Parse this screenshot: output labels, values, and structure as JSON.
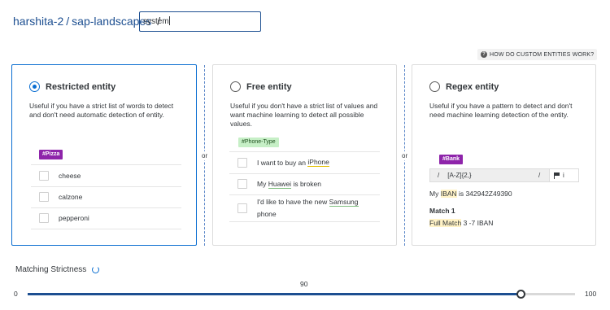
{
  "breadcrumb": {
    "owner": "harshita-2",
    "slash": "/",
    "project": "sap-landscapes",
    "separator": "/"
  },
  "entity_name_input": {
    "value": "system"
  },
  "help_link": {
    "label": "HOW DO CUSTOM ENTITIES WORK?",
    "icon": "question-icon"
  },
  "cards": {
    "restricted": {
      "title": "Restricted entity",
      "selected": true,
      "description": "Useful if you have a strict list of words to detect and don't need automatic detection of entity.",
      "tag": "#Pizza",
      "items": [
        "cheese",
        "calzone",
        "pepperoni"
      ]
    },
    "free": {
      "title": "Free entity",
      "selected": false,
      "description": "Useful if you don't have a strict list of values and want machine learning to detect all possible values.",
      "tag": "#Phone-Type",
      "examples": [
        {
          "before": "I want to buy an",
          "entity": "iPhone",
          "after": ""
        },
        {
          "before": "My",
          "entity": "Huawei",
          "after": "is broken"
        },
        {
          "before": "I'd like to have the new",
          "entity": "Samsung",
          "after": "phone"
        }
      ]
    },
    "regex": {
      "title": "Regex entity",
      "selected": false,
      "description": "Useful if you have a pattern to detect and don't need machine learning detection of the entity.",
      "tag": "#Bank",
      "pattern_open": "/",
      "pattern": "[A-Z]{2,}",
      "pattern_close": "/",
      "flags": "i",
      "test_before": "My",
      "test_match": "IBAN",
      "test_after": "is 342942Z49390",
      "match_title": "Match 1",
      "match_label": "Full Match",
      "match_range": "3 -7 IBAN"
    }
  },
  "separators": {
    "or": "or"
  },
  "strictness": {
    "label": "Matching Strictness",
    "value": 90,
    "min": 0,
    "max": 100,
    "value_text": "90",
    "min_text": "0",
    "max_text": "100"
  },
  "colors": {
    "accent": "#0a6ed1",
    "link": "#1d4f91",
    "tag_purple": "#8e24aa",
    "tag_green": "#c6efc6",
    "match_highlight": "#fff2c6"
  }
}
